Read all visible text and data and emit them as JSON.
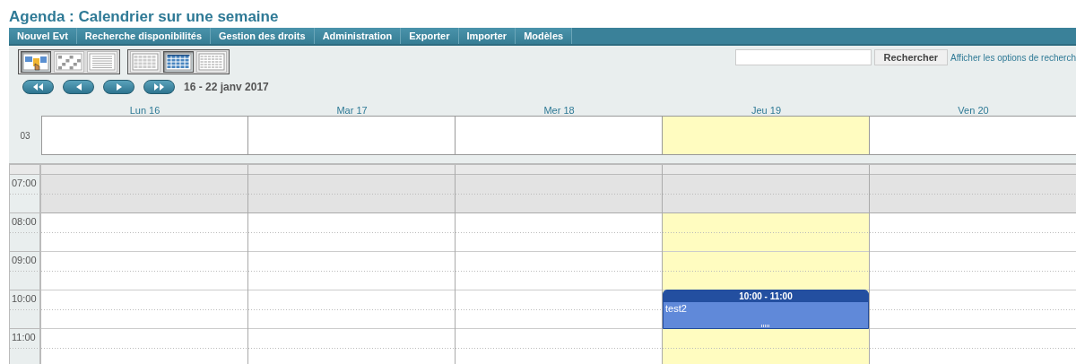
{
  "title": "Agenda : Calendrier sur une semaine",
  "menu": [
    {
      "label": "Nouvel Evt"
    },
    {
      "label": "Recherche disponibilités"
    },
    {
      "label": "Gestion des droits"
    },
    {
      "label": "Administration"
    },
    {
      "label": "Exporter"
    },
    {
      "label": "Importer"
    },
    {
      "label": "Modèles"
    }
  ],
  "view_groups": [
    {
      "views": [
        {
          "kind": "day",
          "selected": true
        },
        {
          "kind": "planning",
          "selected": false
        },
        {
          "kind": "list",
          "selected": false
        }
      ]
    },
    {
      "views": [
        {
          "kind": "grid",
          "selected": false
        },
        {
          "kind": "grid",
          "selected": true
        },
        {
          "kind": "dense-grid",
          "selected": false
        }
      ]
    }
  ],
  "nav_buttons": [
    {
      "kind": "first"
    },
    {
      "kind": "prev"
    },
    {
      "kind": "next"
    },
    {
      "kind": "last"
    }
  ],
  "date_range": "16 - 22 janv 2017",
  "search": {
    "button": "Rechercher",
    "options_link": "Afficher les options de recherch"
  },
  "week_number": "03",
  "days": [
    {
      "label": "Lun 16",
      "today": false
    },
    {
      "label": "Mar 17",
      "today": false
    },
    {
      "label": "Mer 18",
      "today": false
    },
    {
      "label": "Jeu 19",
      "today": true,
      "events": [
        {
          "time": "10:00 - 11:00",
          "title": "test2"
        }
      ]
    },
    {
      "label": "Ven 20",
      "today": false
    }
  ],
  "hours": [
    {
      "label": "07:00",
      "off_hours": true
    },
    {
      "label": "08:00",
      "off_hours": false
    },
    {
      "label": "09:00",
      "off_hours": false
    },
    {
      "label": "10:00",
      "off_hours": false
    },
    {
      "label": "11:00",
      "off_hours": false
    }
  ]
}
